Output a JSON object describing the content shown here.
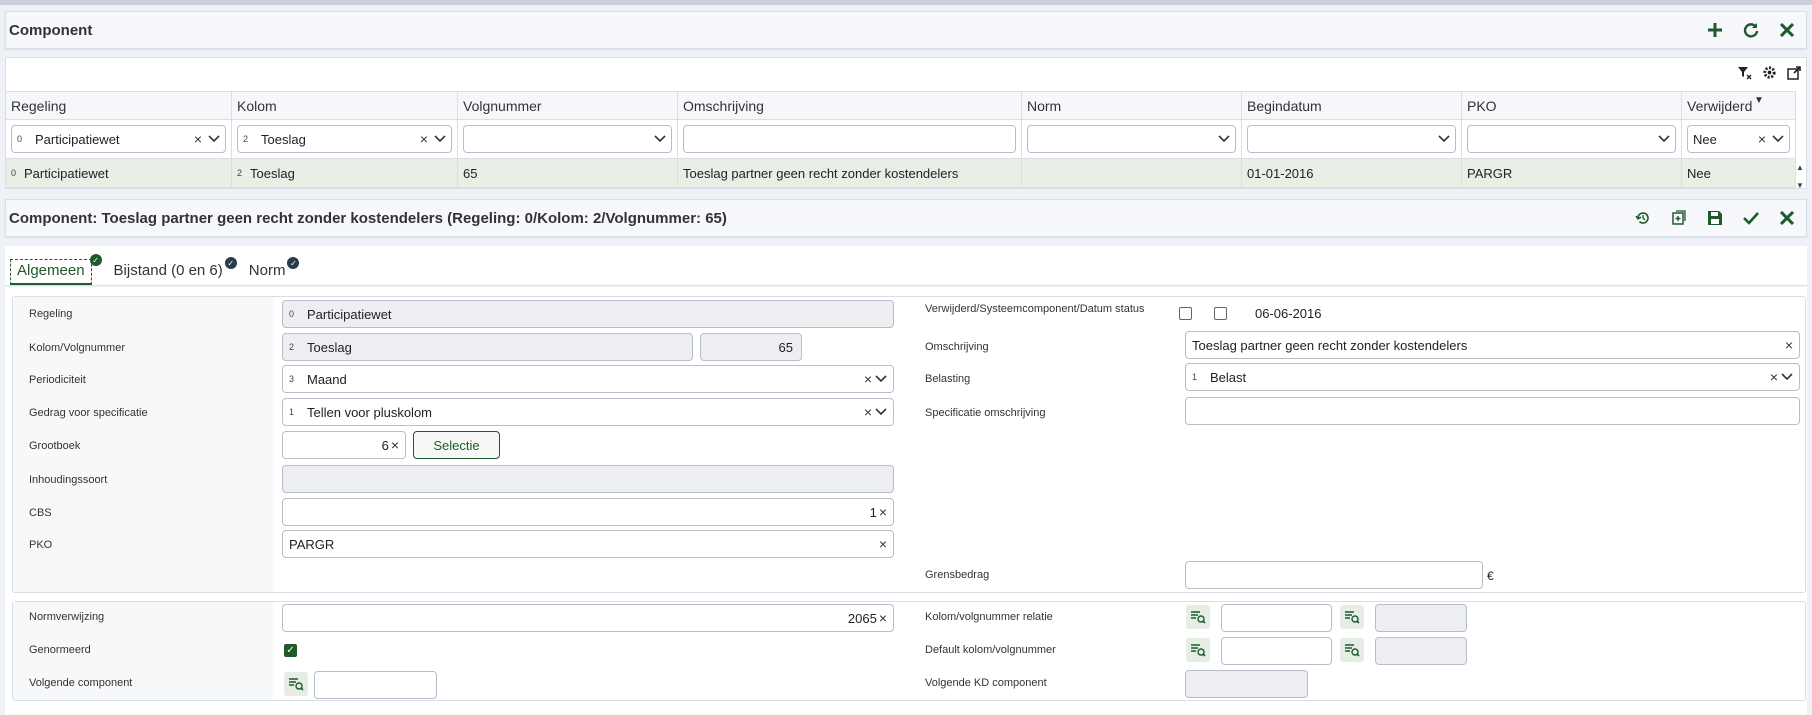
{
  "colors": {
    "accent": "#1e5a2a",
    "selectedRow": "#e8efe6"
  },
  "list_panel": {
    "title": "Component",
    "actions": [
      "add-icon",
      "refresh-icon",
      "close-icon"
    ]
  },
  "grid": {
    "tools": [
      "filter-clear-icon",
      "settings-icon",
      "export-icon"
    ],
    "columns": [
      "Regeling",
      "Kolom",
      "Volgnummer",
      "Omschrijving",
      "Norm",
      "Begindatum",
      "PKO",
      "Verwijderd"
    ],
    "filters": {
      "regeling_code": "0",
      "regeling": "Participatiewet",
      "kolom_code": "2",
      "kolom": "Toeslag",
      "volgnummer": "",
      "omschrijving": "",
      "norm": "",
      "begindatum": "",
      "pko": "",
      "verwijderd": "Nee"
    },
    "rows": [
      {
        "regeling_code": "0",
        "regeling": "Participatiewet",
        "kolom_code": "2",
        "kolom": "Toeslag",
        "volgnummer": "65",
        "omschrijving": "Toeslag partner geen recht zonder kostendelers",
        "norm": "",
        "begindatum": "01-01-2016",
        "pko": "PARGR",
        "verwijderd": "Nee"
      }
    ]
  },
  "detail": {
    "title": "Component: Toeslag partner geen recht zonder kostendelers (Regeling: 0/Kolom: 2/Volgnummer: 65)",
    "actions": [
      "history-icon",
      "add-copy-icon",
      "save-icon",
      "confirm-icon",
      "close-icon"
    ],
    "tabs": [
      {
        "label": "Algemeen",
        "active": true
      },
      {
        "label": "Bijstand (0 en 6)",
        "active": false
      },
      {
        "label": "Norm",
        "active": false
      }
    ],
    "left": {
      "regeling_label": "Regeling",
      "regeling_code": "0",
      "regeling_value": "Participatiewet",
      "kolom_label": "Kolom/Volgnummer",
      "kolom_code": "2",
      "kolom_value": "Toeslag",
      "volgnummer_value": "65",
      "periodiciteit_label": "Periodiciteit",
      "periodiciteit_code": "3",
      "periodiciteit_value": "Maand",
      "gedrag_label": "Gedrag voor specificatie",
      "gedrag_code": "1",
      "gedrag_value": "Tellen voor pluskolom",
      "grootboek_label": "Grootboek",
      "grootboek_value": "6",
      "selectie_label": "Selectie",
      "inhoudingssoort_label": "Inhoudingssoort",
      "inhoudingssoort_value": "",
      "cbs_label": "CBS",
      "cbs_value": "1",
      "pko_label": "PKO",
      "pko_value": "PARGR"
    },
    "right": {
      "status_label": "Verwijderd/Systeemcomponent/Datum status",
      "verwijderd_checked": false,
      "systeem_checked": false,
      "datum_status": "06-06-2016",
      "omschrijving_label": "Omschrijving",
      "omschrijving_value": "Toeslag partner geen recht zonder kostendelers",
      "belasting_label": "Belasting",
      "belasting_code": "1",
      "belasting_value": "Belast",
      "spec_label": "Specificatie omschrijving",
      "spec_value": "",
      "grens_label": "Grensbedrag",
      "grens_value": "",
      "currency": "€"
    },
    "bottom": {
      "normverwijzing_label": "Normverwijzing",
      "normverwijzing_value": "2065",
      "genormeerd_label": "Genormeerd",
      "genormeerd_checked": true,
      "volgende_label": "Volgende component",
      "volgende_value": "",
      "relatie_label": "Kolom/volgnummer relatie",
      "relatie_value": "",
      "relatie_value2": "",
      "default_label": "Default kolom/volgnummer",
      "default_value": "",
      "default_value2": "",
      "volgende_kd_label": "Volgende KD component",
      "volgende_kd_value": ""
    }
  }
}
